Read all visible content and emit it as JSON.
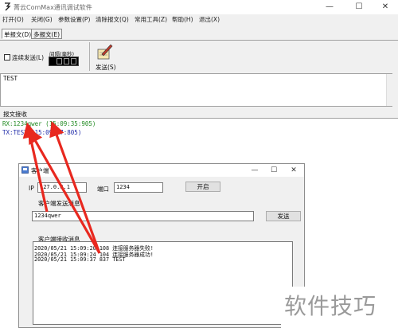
{
  "app": {
    "title": "菁云ComMax通讯调试软件",
    "window_controls": [
      "—",
      "☐",
      "✕"
    ]
  },
  "menu": [
    "打开(O)",
    "关闭(G)",
    "参数设置(P)",
    "清除报文(Q)",
    "常用工具(Z)",
    "帮助(H)",
    "退出(X)"
  ],
  "tabs": [
    "单报文(D)",
    "多报文(E)"
  ],
  "toolbar": {
    "continuous_send_label": "连续发送(L)",
    "interval_label": "间隔(毫秒)",
    "send_label": "发送(S)"
  },
  "send_text": "TEST",
  "receive": {
    "heading": "报文接收",
    "rx": "RX:1234qwer (15:09:35:905)",
    "tx": "TX:TEST (15:09:37:805)"
  },
  "client": {
    "title": "客户端",
    "ip_label": "IP",
    "ip_value": "127.0.0.1",
    "port_label": "端口",
    "port_value": "1234",
    "open_button": "开启",
    "send_msg_label": "客户端发送消息",
    "send_msg_value": "1234qwer",
    "send_button": "发送",
    "recv_msg_label": "客户端接收消息",
    "log": [
      "2020/05/21 15:09:20 108 连接服务器失败!",
      "2020/05/21 15:09:24 104 连接服务器成功!",
      "2020/05/21 15:09:37 837 TEST"
    ]
  },
  "watermark": "软件技巧",
  "colors": {
    "rx": "#228b22",
    "tx": "#1f2aa8",
    "arrow": "#e8281f"
  }
}
